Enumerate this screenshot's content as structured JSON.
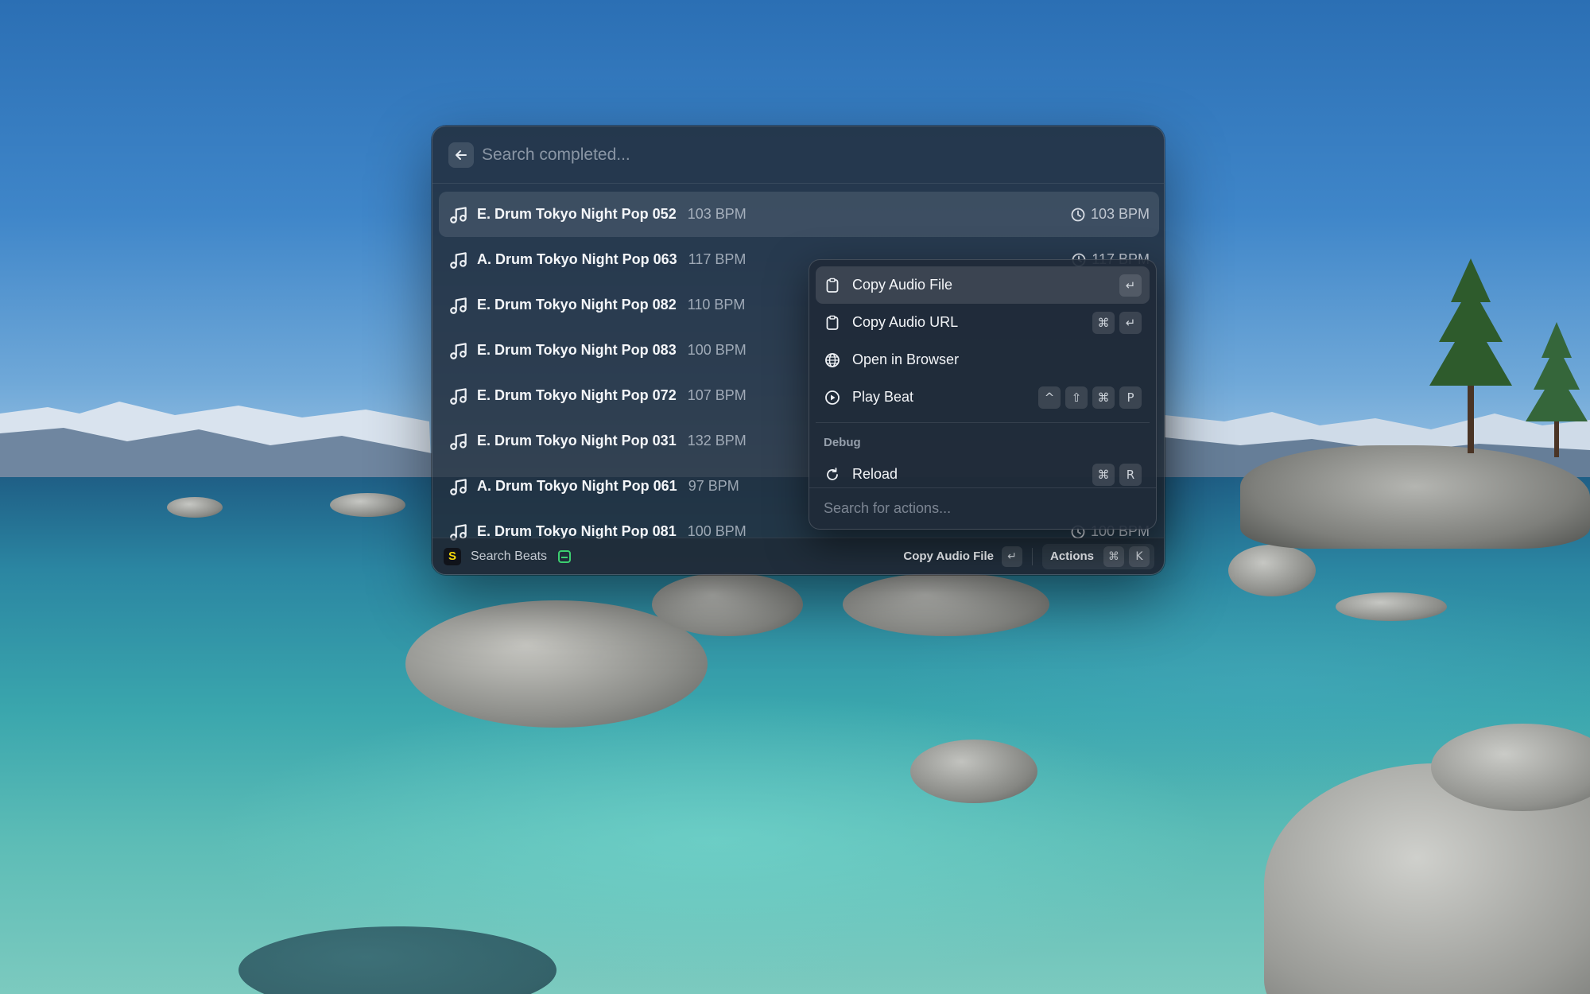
{
  "search": {
    "placeholder": "Search completed..."
  },
  "items": [
    {
      "title": "E. Drum Tokyo Night Pop 052",
      "bpm": "103 BPM",
      "accessory": "103 BPM"
    },
    {
      "title": "A. Drum Tokyo Night Pop 063",
      "bpm": "117 BPM",
      "accessory": "117 BPM"
    },
    {
      "title": "E. Drum Tokyo Night Pop 082",
      "bpm": "110 BPM",
      "accessory": ""
    },
    {
      "title": "E. Drum Tokyo Night Pop 083",
      "bpm": "100 BPM",
      "accessory": ""
    },
    {
      "title": "E. Drum Tokyo Night Pop 072",
      "bpm": "107 BPM",
      "accessory": ""
    },
    {
      "title": "E. Drum Tokyo Night Pop 031",
      "bpm": "132 BPM",
      "accessory": ""
    },
    {
      "title": "A. Drum Tokyo Night Pop 061",
      "bpm": "97 BPM",
      "accessory": ""
    },
    {
      "title": "E. Drum Tokyo Night Pop 081",
      "bpm": "100 BPM",
      "accessory": "100 BPM"
    }
  ],
  "actions": [
    {
      "label": "Copy Audio File",
      "icon": "clipboard-icon",
      "shortcut": [
        "↵"
      ]
    },
    {
      "label": "Copy Audio URL",
      "icon": "clipboard-icon",
      "shortcut": [
        "⌘",
        "↵"
      ]
    },
    {
      "label": "Open in Browser",
      "icon": "globe-icon",
      "shortcut": []
    },
    {
      "label": "Play Beat",
      "icon": "play-circle-icon",
      "shortcut": [
        "^",
        "⇧",
        "⌘",
        "P"
      ]
    }
  ],
  "debug_section": {
    "title": "Debug",
    "actions": [
      {
        "label": "Reload",
        "icon": "reload-icon",
        "shortcut": [
          "⌘",
          "R"
        ]
      }
    ]
  },
  "action_search": {
    "placeholder": "Search for actions..."
  },
  "footer": {
    "extension_logo": "S",
    "extension_name": "Search Beats",
    "primary_action": "Copy Audio File",
    "primary_key": "↵",
    "actions_label": "Actions",
    "actions_keys": [
      "⌘",
      "K"
    ]
  },
  "colors": {
    "accent_green": "#3ccf70",
    "logo_yellow": "#f5d90a"
  }
}
